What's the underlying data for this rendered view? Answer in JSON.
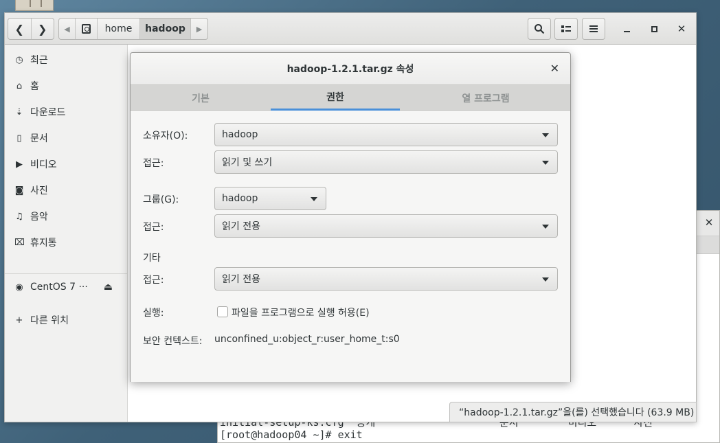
{
  "terminal": {
    "close_glyph": "✕",
    "line1": "initial-setup-ks.cfg  공개                    문서        비디오      사진",
    "line2": "[root@hadoop04 ~]# exit"
  },
  "file_manager": {
    "path": {
      "home": "home",
      "current": "hadoop"
    },
    "sidebar": {
      "items": [
        {
          "icon": "clock-icon",
          "glyph": "◷",
          "label": "최근"
        },
        {
          "icon": "home-icon",
          "glyph": "⌂",
          "label": "홈"
        },
        {
          "icon": "download-icon",
          "glyph": "⇣",
          "label": "다운로드"
        },
        {
          "icon": "document-icon",
          "glyph": "▯",
          "label": "문서"
        },
        {
          "icon": "video-icon",
          "glyph": "▶",
          "label": "비디오"
        },
        {
          "icon": "camera-icon",
          "glyph": "◙",
          "label": "사진"
        },
        {
          "icon": "music-icon",
          "glyph": "♫",
          "label": "음악"
        },
        {
          "icon": "trash-icon",
          "glyph": "⌧",
          "label": "휴지통"
        }
      ],
      "device": {
        "icon": "disc-icon",
        "glyph": "◉",
        "label": "CentOS 7 ···",
        "eject": "⏏"
      },
      "other": {
        "icon": "plus-icon",
        "glyph": "+",
        "label": "다른 위치"
      }
    },
    "statusbar": "“hadoop-1.2.1.tar.gz”을(를) 선택했습니다  (63.9 MB)"
  },
  "dialog": {
    "title": "hadoop-1.2.1.tar.gz 속성",
    "close_glyph": "✕",
    "tabs": [
      "기본",
      "권한",
      "열 프로그램"
    ],
    "active_tab": "권한",
    "owner_label": "소유자(O):",
    "owner_value": "hadoop",
    "owner_access_label": "접근:",
    "owner_access_value": "읽기 및 쓰기",
    "group_label": "그룹(G):",
    "group_value": "hadoop",
    "group_access_label": "접근:",
    "group_access_value": "읽기 전용",
    "others_heading": "기타",
    "others_access_label": "접근:",
    "others_access_value": "읽기 전용",
    "execute_label": "실행:",
    "execute_checkbox_label": "파일을 프로그램으로 실행 허용(E)",
    "execute_checked": false,
    "security_label": "보안 컨텍스트:",
    "security_value": "unconfined_u:object_r:user_home_t:s0"
  },
  "colors": {
    "accent": "#4a90d9"
  }
}
